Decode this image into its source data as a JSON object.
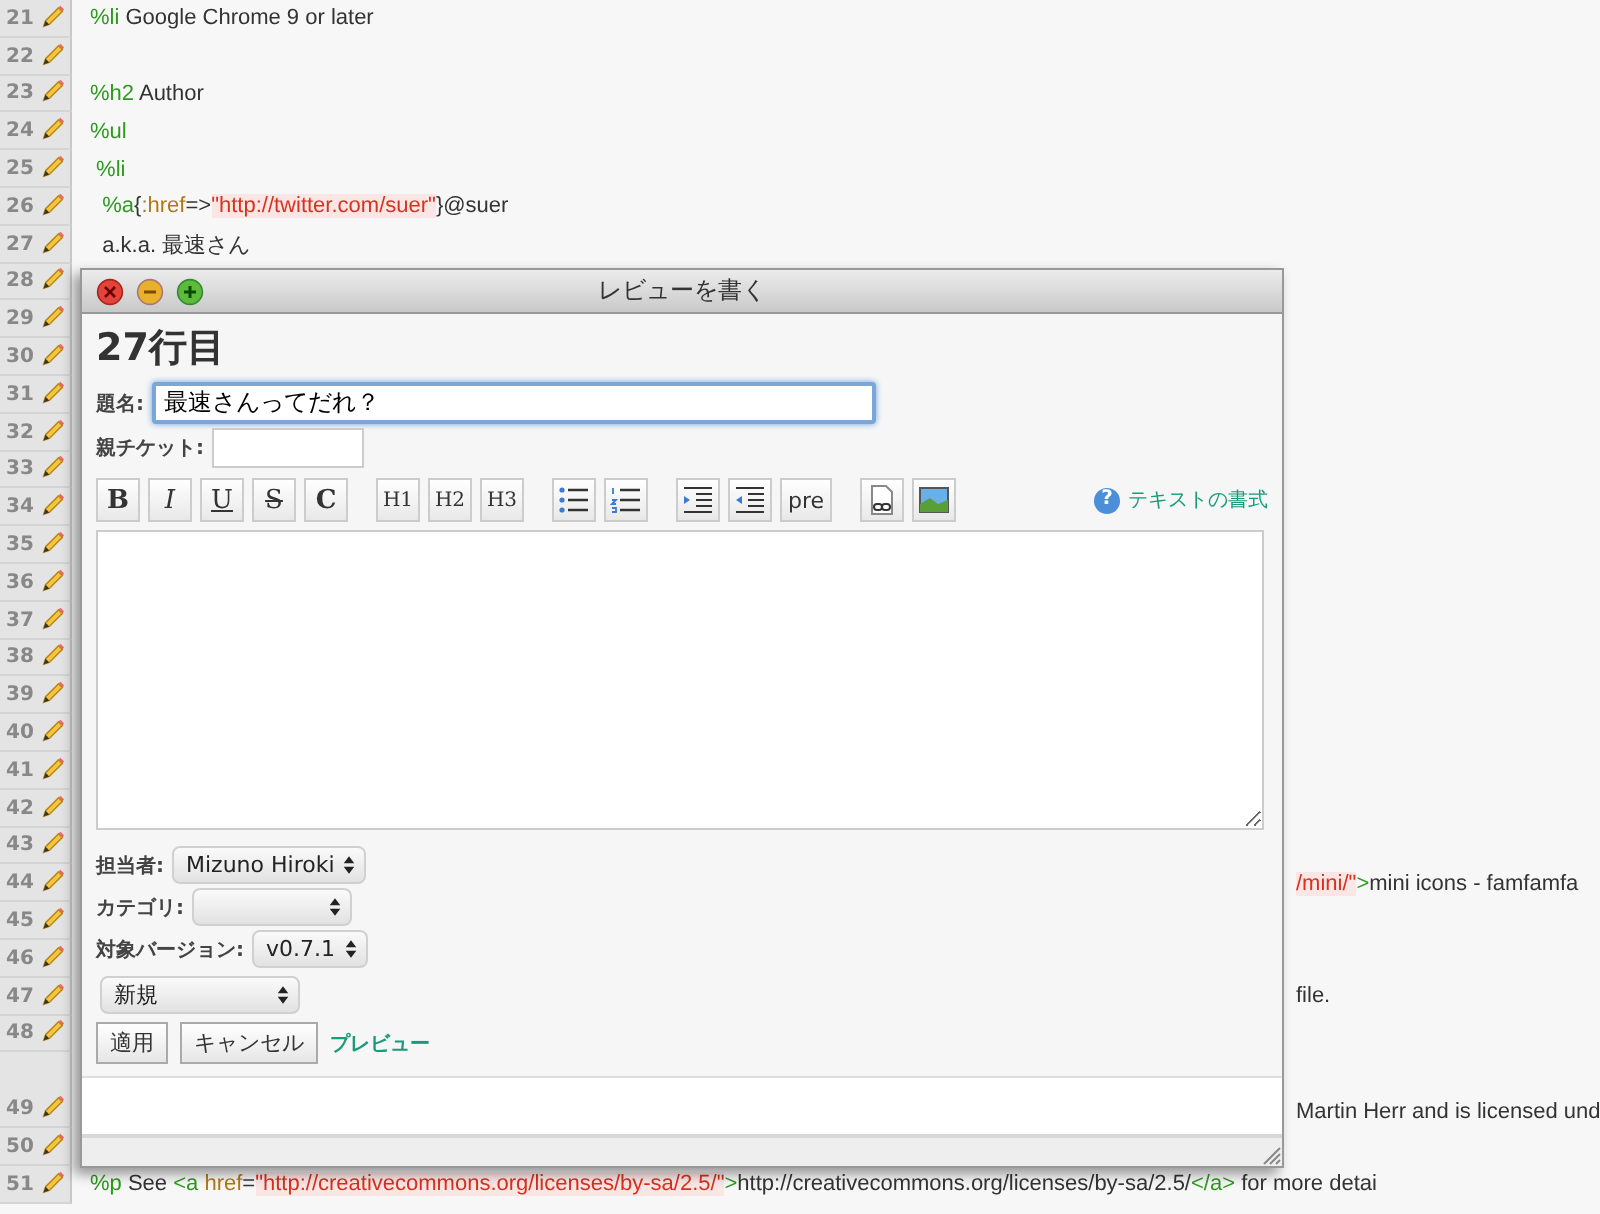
{
  "editor": {
    "lines": [
      {
        "num": "21",
        "wrapped": false,
        "tokens": [
          {
            "kind": "tag",
            "text": "%li"
          },
          {
            "kind": "plain",
            "text": " Google Chrome 9 or later"
          }
        ]
      },
      {
        "num": "22",
        "wrapped": false
      },
      {
        "num": "23",
        "wrapped": false,
        "tokens": [
          {
            "kind": "tag",
            "text": "%h2"
          },
          {
            "kind": "plain",
            "text": " Author"
          }
        ]
      },
      {
        "num": "24",
        "wrapped": false,
        "tokens": [
          {
            "kind": "tag",
            "text": "%ul"
          }
        ]
      },
      {
        "num": "25",
        "wrapped": false,
        "tokens": [
          {
            "kind": "tag",
            "text": " %li"
          }
        ]
      },
      {
        "num": "26",
        "wrapped": false,
        "tokens": [
          {
            "kind": "tag",
            "text": "  %a"
          },
          {
            "kind": "plain",
            "text": "{"
          },
          {
            "kind": "attr",
            "text": ":href"
          },
          {
            "kind": "plain",
            "text": "=>"
          },
          {
            "kind": "string",
            "text": "\"http://twitter.com/suer\""
          },
          {
            "kind": "plain",
            "text": "}@suer"
          }
        ]
      },
      {
        "num": "27",
        "wrapped": false,
        "tokens": [
          {
            "kind": "plain",
            "text": "  a.k.a. 最速さん"
          }
        ]
      },
      {
        "num": "28",
        "wrapped": false
      },
      {
        "num": "29",
        "wrapped": false
      },
      {
        "num": "30",
        "wrapped": false
      },
      {
        "num": "31",
        "wrapped": false
      },
      {
        "num": "32",
        "wrapped": false
      },
      {
        "num": "33",
        "wrapped": false
      },
      {
        "num": "34",
        "wrapped": false
      },
      {
        "num": "35",
        "wrapped": false
      },
      {
        "num": "36",
        "wrapped": false
      },
      {
        "num": "37",
        "wrapped": false
      },
      {
        "num": "38",
        "wrapped": false
      },
      {
        "num": "39",
        "wrapped": false
      },
      {
        "num": "40",
        "wrapped": false
      },
      {
        "num": "41",
        "wrapped": false
      },
      {
        "num": "42",
        "wrapped": false
      },
      {
        "num": "43",
        "wrapped": false
      },
      {
        "num": "44",
        "wrapped": false,
        "tail": [
          {
            "kind": "string",
            "text": "/mini/\""
          },
          {
            "kind": "tag",
            "text": ">"
          },
          {
            "kind": "plain",
            "text": "mini icons - famfamfa"
          }
        ]
      },
      {
        "num": "45",
        "wrapped": false
      },
      {
        "num": "46",
        "wrapped": false
      },
      {
        "num": "47",
        "wrapped": false,
        "tail": [
          {
            "kind": "plain",
            "text": "file."
          }
        ]
      },
      {
        "num": "48",
        "wrapped": false
      },
      {
        "num": "49",
        "wrapped": true,
        "tail": [
          {
            "kind": "plain",
            "text": "Martin Herr and is licensed und"
          }
        ]
      },
      {
        "num": "50",
        "wrapped": false
      },
      {
        "num": "51",
        "wrapped": false,
        "tokens": [
          {
            "kind": "tag",
            "text": "%p"
          },
          {
            "kind": "plain",
            "text": " See "
          },
          {
            "kind": "tag",
            "text": "<a"
          },
          {
            "kind": "attr",
            "text": " href"
          },
          {
            "kind": "plain",
            "text": "="
          },
          {
            "kind": "string",
            "text": "\"http://creativecommons.org/licenses/by-sa/2.5/\""
          },
          {
            "kind": "tag",
            "text": ">"
          },
          {
            "kind": "plain",
            "text": "http://creativecommons.org/licenses/by-sa/2.5/"
          },
          {
            "kind": "tag",
            "text": "</a>"
          },
          {
            "kind": "plain",
            "text": " for more detai"
          }
        ]
      }
    ]
  },
  "dialog": {
    "title": "レビューを書く",
    "heading": "27行目",
    "subject": {
      "label": "題名:",
      "value": "最速さんってだれ？"
    },
    "parent": {
      "label": "親チケット:"
    },
    "toolbar": {
      "format": [
        "B",
        "I",
        "U",
        "S",
        "C"
      ],
      "headings": [
        "H1",
        "H2",
        "H3"
      ],
      "pre": "pre",
      "help_icon": "?",
      "help": "テキストの書式"
    },
    "selects": [
      {
        "label": "担当者:",
        "value": "Mizuno Hiroki"
      },
      {
        "label": "カテゴリ:"
      },
      {
        "label": "対象バージョン:",
        "value": "v0.7.1"
      }
    ],
    "status": {
      "value": "新規"
    },
    "buttons": [
      "適用",
      "キャンセル"
    ],
    "preview": "プレビュー"
  }
}
